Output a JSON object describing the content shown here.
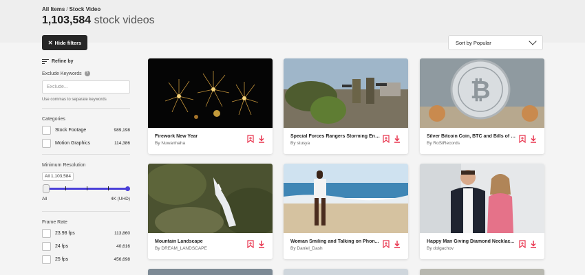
{
  "breadcrumb": {
    "root": "All Items",
    "separator": "/",
    "current": "Stock Video"
  },
  "header": {
    "count": "1,103,584",
    "title_suffix": "stock videos"
  },
  "toolbar": {
    "hide_filters_label": "Hide filters",
    "hide_filters_icon": "close-icon",
    "sort_label": "Sort by Popular"
  },
  "sidebar": {
    "refine_label": "Refine by",
    "exclude": {
      "label": "Exclude Keywords",
      "placeholder": "Exclude...",
      "hint": "Use commas to separate keywords"
    },
    "categories": {
      "label": "Categories",
      "items": [
        {
          "label": "Stock Footage",
          "count": "989,198"
        },
        {
          "label": "Motion Graphics",
          "count": "114,386"
        }
      ]
    },
    "resolution": {
      "label": "Minimum Resolution",
      "tooltip": "All 1,103,584",
      "min_label": "All",
      "max_label": "4K (UHD)"
    },
    "frame_rate": {
      "label": "Frame Rate",
      "items": [
        {
          "label": "23.98 fps",
          "count": "113,860"
        },
        {
          "label": "24 fps",
          "count": "40,616"
        },
        {
          "label": "25 fps",
          "count": "456,698"
        }
      ]
    }
  },
  "cards": [
    {
      "title": "Firework New Year",
      "author": "By Nuwanhaha"
    },
    {
      "title": "Special Forces Rangers Storming Ene...",
      "author": "By stusya"
    },
    {
      "title": "Silver Bitcoin Coin, BTC and Bills of D...",
      "author": "By RoStRecords"
    },
    {
      "title": "Mountain Landscape",
      "author": "By DREAM_LANDSCAPE"
    },
    {
      "title": "Woman Smiling and Talking on Phon...",
      "author": "By Daniel_Dash"
    },
    {
      "title": "Happy Man Giving Diamond Necklac...",
      "author": "By dolgachov"
    }
  ],
  "colors": {
    "accent": "#e8344e",
    "slider": "#4a3fd8",
    "button_dark": "#262626"
  }
}
